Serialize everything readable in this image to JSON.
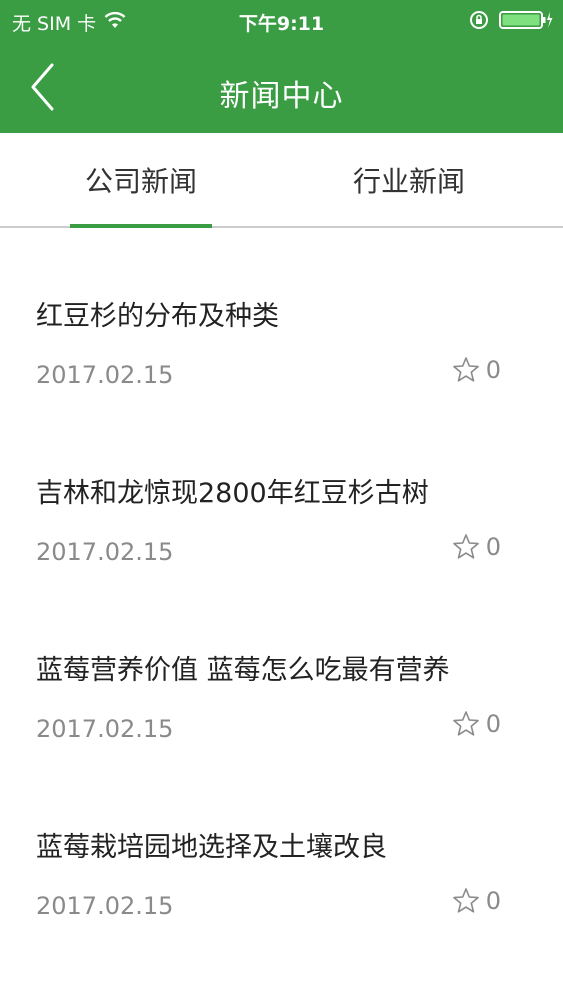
{
  "statusbar": {
    "carrier": "无 SIM 卡",
    "time": "下午9:11",
    "wifi_icon": "wifi-icon",
    "lock_icon": "rotation-lock-icon",
    "battery_icon": "battery-charging-icon"
  },
  "navbar": {
    "title": "新闻中心",
    "back_icon": "chevron-left-icon"
  },
  "tabs": [
    {
      "label": "公司新闻",
      "selected": true
    },
    {
      "label": "行业新闻",
      "selected": false
    }
  ],
  "news": [
    {
      "title": "红豆杉的分布及种类",
      "date": "2017.02.15",
      "favorites": "0"
    },
    {
      "title": "吉林和龙惊现2800年红豆杉古树",
      "date": "2017.02.15",
      "favorites": "0"
    },
    {
      "title": "蓝莓营养价值 蓝莓怎么吃最有营养",
      "date": "2017.02.15",
      "favorites": "0"
    },
    {
      "title": "蓝莓栽培园地选择及土壤改良",
      "date": "2017.02.15",
      "favorites": "0"
    }
  ],
  "colors": {
    "accent": "#3a9d43",
    "text_primary": "#222222",
    "text_secondary": "#8a8a8a"
  }
}
